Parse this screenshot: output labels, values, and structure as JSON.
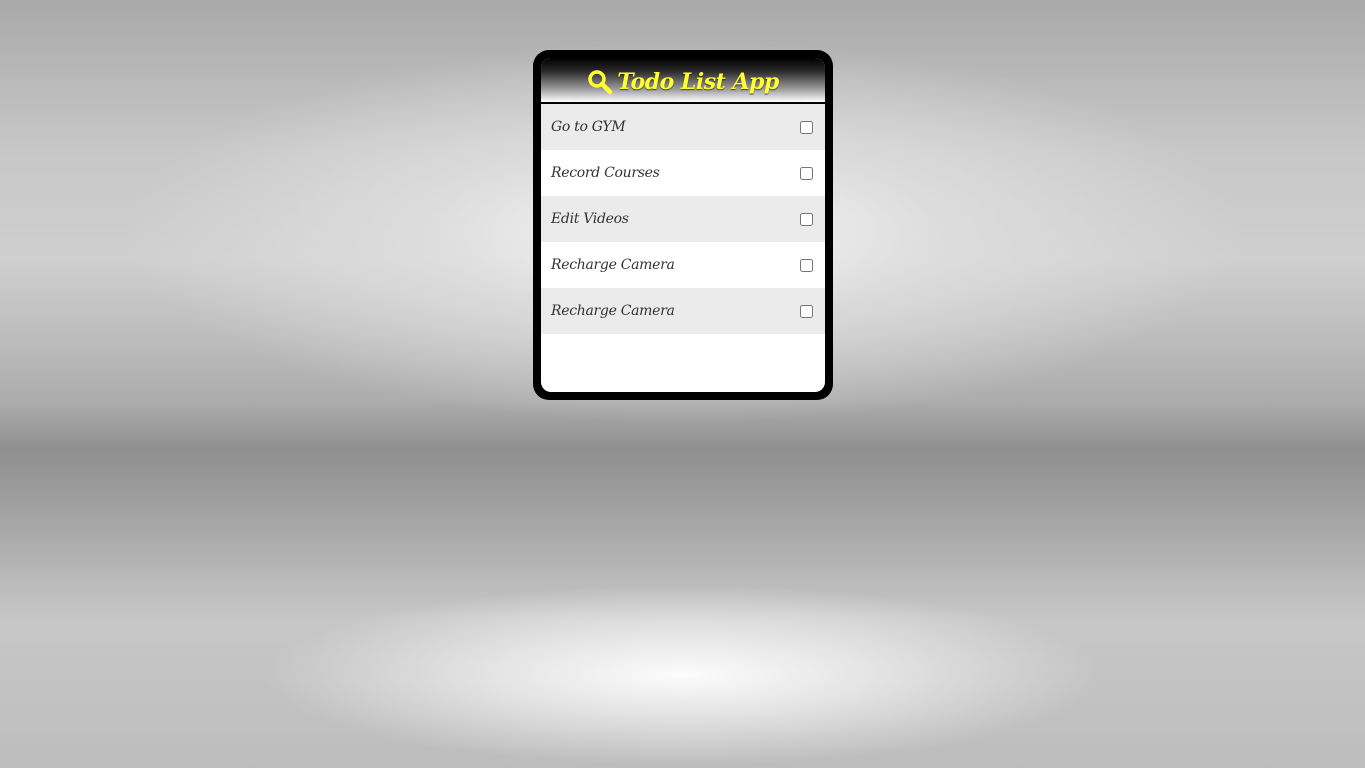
{
  "app": {
    "title": "Todo List App",
    "title_color": "#ffff33",
    "header_icon": "search-icon"
  },
  "todos": [
    {
      "label": "Go to GYM",
      "checked": false
    },
    {
      "label": "Record Courses",
      "checked": false
    },
    {
      "label": "Edit Videos",
      "checked": false
    },
    {
      "label": "Recharge Camera",
      "checked": false
    },
    {
      "label": "Recharge Camera",
      "checked": false
    }
  ]
}
